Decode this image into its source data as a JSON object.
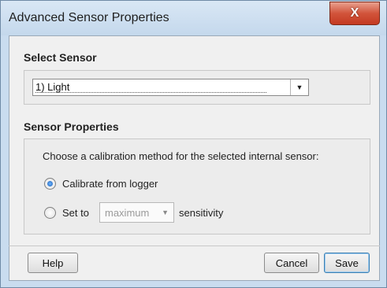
{
  "window": {
    "title": "Advanced Sensor Properties",
    "close_label": "X"
  },
  "select_sensor": {
    "heading": "Select Sensor",
    "selected_value": "1) Light",
    "arrow_icon": "chevron-down-icon"
  },
  "sensor_properties": {
    "heading": "Sensor Properties",
    "instruction": "Choose a calibration method for the selected internal sensor:",
    "options": [
      {
        "label": "Calibrate from logger",
        "checked": true
      },
      {
        "label_before": "Set to",
        "label_after": "sensitivity",
        "checked": false
      }
    ],
    "sensitivity_select": {
      "value": "maximum",
      "enabled": false
    }
  },
  "footer": {
    "help_label": "Help",
    "cancel_label": "Cancel",
    "save_label": "Save"
  },
  "colors": {
    "title_bar": "#c9dcef",
    "close_button": "#c43a22",
    "client_bg": "#f0f0f0",
    "radio_selected": "#1a5fb4",
    "default_button_border": "#3c7fb1"
  }
}
